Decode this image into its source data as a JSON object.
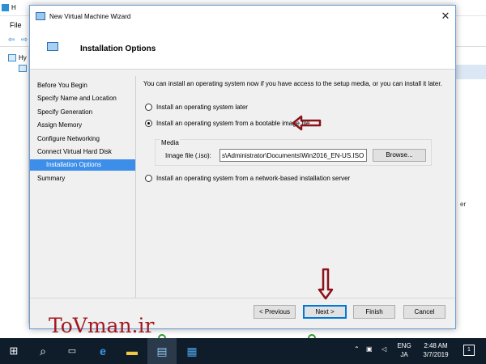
{
  "background": {
    "title": "H",
    "menu_file": "File",
    "tree_item": "Hy",
    "right_items": [
      "",
      "",
      "",
      "",
      "er"
    ]
  },
  "wizard": {
    "window_title": "New Virtual Machine Wizard",
    "page_title": "Installation Options",
    "nav": [
      "Before You Begin",
      "Specify Name and Location",
      "Specify Generation",
      "Assign Memory",
      "Configure Networking",
      "Connect Virtual Hard Disk",
      "Installation Options",
      "Summary"
    ],
    "active_nav": "Installation Options",
    "intro": "You can install an operating system now if you have access to the setup media, or you can install it later.",
    "options": [
      {
        "label": "Install an operating system later",
        "checked": false
      },
      {
        "label": "Install an operating system from a bootable image file",
        "checked": true
      },
      {
        "label": "Install an operating system from a network-based installation server",
        "checked": false
      }
    ],
    "media": {
      "legend": "Media",
      "image_label": "Image file (.iso):",
      "image_value": "s\\Administrator\\Documents\\Win2016_EN-US.ISO",
      "browse": "Browse..."
    },
    "buttons": {
      "previous": "< Previous",
      "next": "Next >",
      "finish": "Finish",
      "cancel": "Cancel"
    }
  },
  "watermark": "ToVman.ir",
  "taskbar": {
    "lang_top": "ENG",
    "lang_bottom": "JA",
    "time": "2:48 AM",
    "date": "3/7/2019",
    "notifications": "1"
  },
  "colors": {
    "accent": "#3c8ee8",
    "arrow": "#8b1219",
    "watermark": "#a3171e",
    "taskbar": "#0f1d2b"
  }
}
